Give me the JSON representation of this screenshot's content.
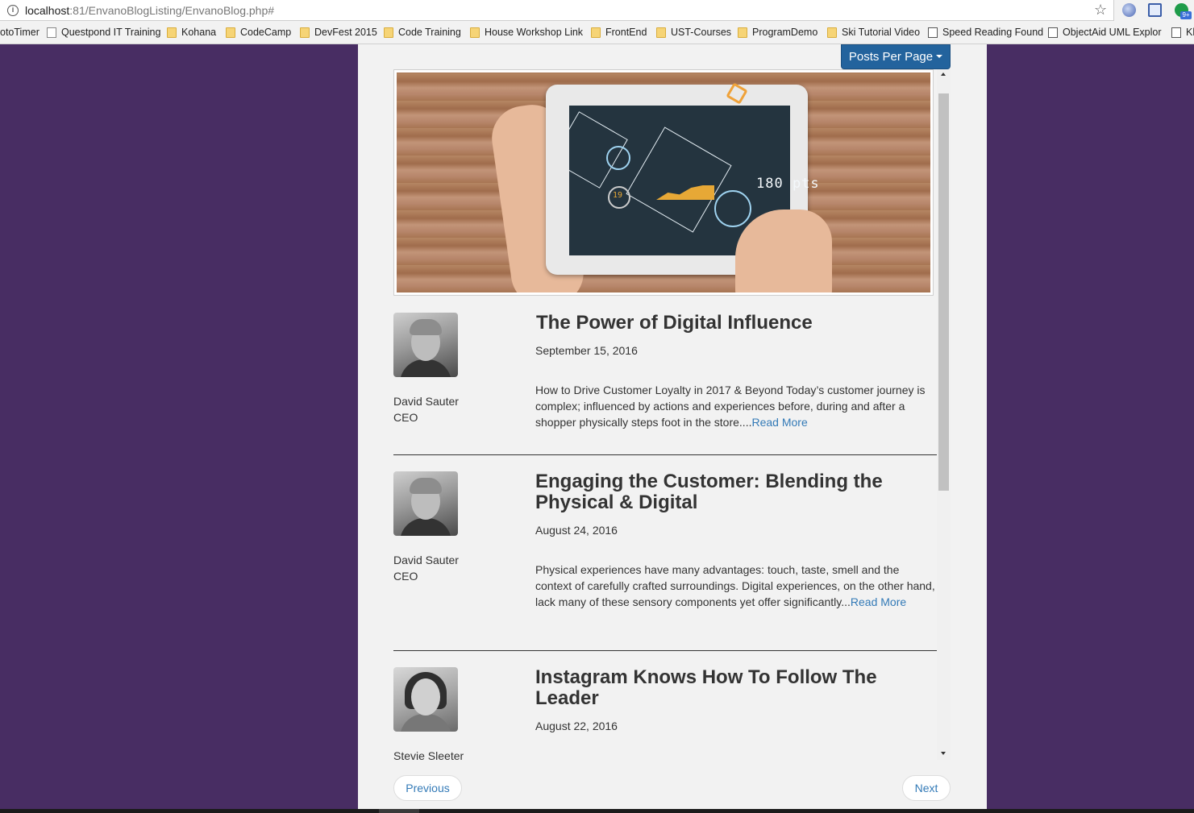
{
  "browser": {
    "url_host": "localhost",
    "url_rest": ":81/EnvanoBlogListing/EnvanoBlog.php#",
    "bookmarks": [
      {
        "label": "otoTimer",
        "icon": "none"
      },
      {
        "label": "Questpond IT Training",
        "icon": "page-icon"
      },
      {
        "label": "Kohana",
        "icon": "folder-icon"
      },
      {
        "label": "CodeCamp",
        "icon": "folder-icon"
      },
      {
        "label": "DevFest 2015",
        "icon": "folder-icon"
      },
      {
        "label": "Code Training",
        "icon": "folder-icon"
      },
      {
        "label": "House Workshop Link",
        "icon": "folder-icon"
      },
      {
        "label": "FrontEnd",
        "icon": "folder-icon"
      },
      {
        "label": "UST-Courses",
        "icon": "folder-icon"
      },
      {
        "label": "ProgramDemo",
        "icon": "folder-icon"
      },
      {
        "label": "Ski Tutorial Video",
        "icon": "folder-icon"
      },
      {
        "label": "Speed Reading Found",
        "icon": "app-icon"
      },
      {
        "label": "ObjectAid UML Explor",
        "icon": "app-icon"
      },
      {
        "label": "Kh",
        "icon": "app-icon"
      }
    ],
    "extension_badge": "9+"
  },
  "page": {
    "posts_per_page_label": "Posts Per Page",
    "hero_overlay_text": "180 pts",
    "hero_badge_text": "19",
    "posts": [
      {
        "title": "The Power of Digital Influence",
        "date": "September 15, 2016",
        "author_name": "David Sauter",
        "author_role": "CEO",
        "excerpt": "How to Drive Customer Loyalty in 2017 & Beyond Today’s customer journey is complex; influenced by actions and experiences before, during and after a shopper physically steps foot in the store....",
        "read_more": "Read More"
      },
      {
        "title": "Engaging the Customer: Blending the Physical & Digital",
        "date": "August 24, 2016",
        "author_name": "David Sauter",
        "author_role": "CEO",
        "excerpt": "Physical experiences have many advantages: touch, taste, smell and the context of carefully crafted surroundings. Digital experiences, on the other hand, lack many of these sensory components yet offer significantly...",
        "read_more": "Read More"
      },
      {
        "title": "Instagram Knows How To Follow The Leader",
        "date": "August 22, 2016",
        "author_name": "Stevie Sleeter",
        "author_role": ""
      }
    ],
    "pager": {
      "previous": "Previous",
      "next": "Next"
    }
  },
  "colors": {
    "page_background": "#482d63",
    "content_background": "#f2f2f2",
    "primary_button": "#23639d",
    "link": "#337ab7"
  }
}
